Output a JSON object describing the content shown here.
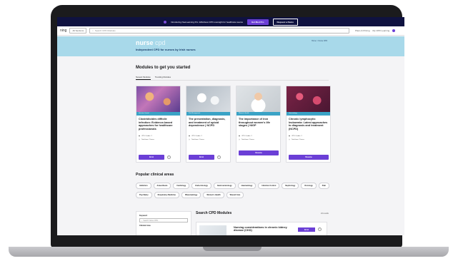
{
  "promo": {
    "text": "Introducing NeoLearning Pro: Effortless CPD oversight for healthcare teams",
    "primary_button": "Get Med Pro",
    "secondary_button": "Request a Demo"
  },
  "topbar": {
    "logo_fragment": "ning",
    "sections_label": "All Sections",
    "search_placeholder": "Search CPD Modules",
    "links": [
      "Plans & Pricing",
      "My CPD Learning"
    ]
  },
  "hero": {
    "brand_main": "nurse",
    "brand_sub": "cpd",
    "tagline": "Independent CPD for nurses by Irish nurses",
    "breadcrumb": "Home > Nurse CPD"
  },
  "modules": {
    "title": "Modules to get you started",
    "tabs": [
      "Newest Modules",
      "Trending Modules"
    ],
    "cards": [
      {
        "tag": "Infection Control",
        "title": "Clostridioides difficile infection: Evidence-based approaches for healthcare professionals",
        "credits": "CPD Credits: 2",
        "time": "Total time: 2 hours",
        "button": "Enrol",
        "image": "bacteria-illustration"
      },
      {
        "tag": "Pain Management",
        "title": "The presentation, diagnosis, and treatment of opioid dependence | NCPD",
        "credits": "CPD Credits: 2",
        "time": "Total time: 2 hours",
        "button": "Enrol",
        "image": "pills-photo"
      },
      {
        "tag": "Women's Health",
        "title": "The importance of iron throughout women's life stages | NIGP",
        "credits": "CPD Credits: 2",
        "time": "Total time: 2 hours",
        "button": "Resume",
        "image": "woman-portrait-photo"
      },
      {
        "tag": "Haematology",
        "title": "Chronic lymphocytic leukaemia: Latest approaches to diagnosis and treatment (NCPD)",
        "credits": "CPD Credits: 2",
        "time": "Total time: 2 hours",
        "button": "Resume",
        "image": "blood-cells-illustration"
      }
    ]
  },
  "clinical": {
    "title": "Popular clinical areas",
    "chips": [
      "Addiction",
      "Anaesthesia",
      "Cardiology",
      "Endocrinology",
      "Gastroenterology",
      "Haematology",
      "Infection Control",
      "Nephrology",
      "Oncology",
      "Pain",
      "Psychiatry",
      "Respiratory Medicine",
      "Rheumatology",
      "Women's Health",
      "Wound Care"
    ]
  },
  "search_cpd": {
    "title": "Search CPD Modules",
    "results": "24 results",
    "filter_keyword_label": "Keyword",
    "filter_keyword_placeholder": "Search Nurse CPD...",
    "filter_area_label": "Clinical Area",
    "first_result_title": "Nursing considerations in chronic kidney disease (CKD)",
    "first_result_button": "Enrol"
  },
  "colors": {
    "accent": "#6b3fd6",
    "hero_bg": "#a8d9ea",
    "promo_bg": "#0f1240",
    "tag_bg": "#3aa3c6"
  }
}
